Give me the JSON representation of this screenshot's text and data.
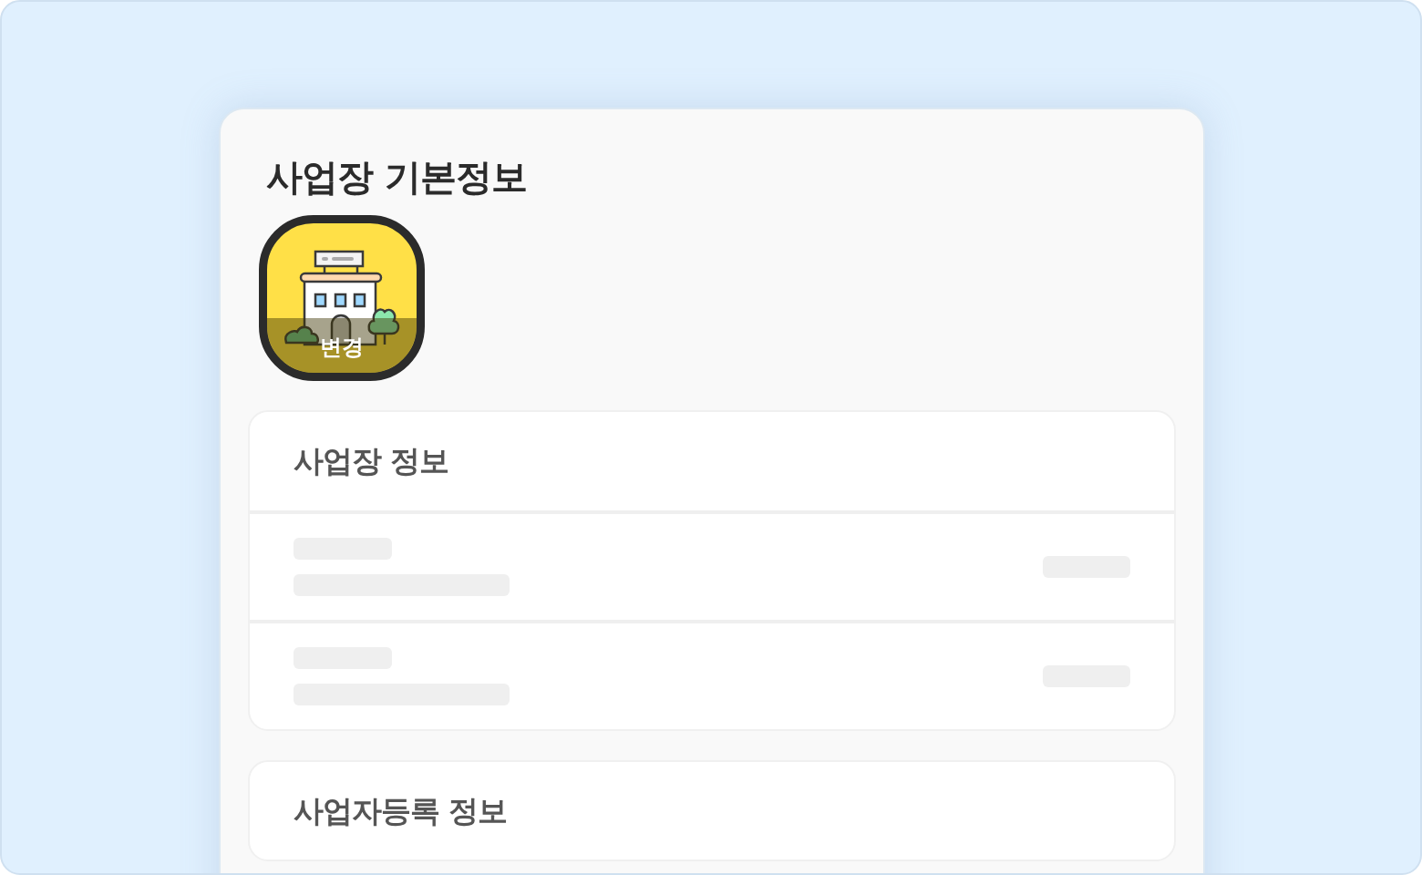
{
  "page": {
    "title": "사업장 기본정보"
  },
  "profile_image": {
    "button_label": "변경"
  },
  "sections": [
    {
      "title": "사업장 정보",
      "rows": [
        {
          "loading": true
        },
        {
          "loading": true
        }
      ]
    },
    {
      "title": "사업자등록 정보"
    }
  ]
}
